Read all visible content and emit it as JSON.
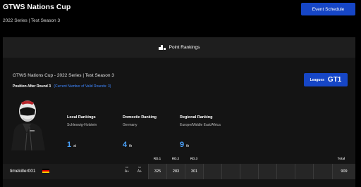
{
  "header": {
    "title": "GTWS Nations Cup",
    "subtitle": "2022 Series | Test Season 3",
    "event_schedule_label": "Event Schedule"
  },
  "panel": {
    "heading": "Point Rankings",
    "championship": "GTWS Nations Cup - 2022 Series | Test Season 3",
    "position_label": "Position After Round 3",
    "valid_rounds": "(Current Number of Valid Rounds: 3)",
    "leagues_label": "Leagues",
    "leagues_value": "GT1"
  },
  "rankings": [
    {
      "heading": "Local Rankings",
      "scope": "Schleswig-Holstein",
      "number": "1",
      "suffix": "st"
    },
    {
      "heading": "Domestic Ranking",
      "scope": "Germany",
      "number": "4",
      "suffix": "th"
    },
    {
      "heading": "Regional Ranking",
      "scope": "Europe/Middle East/Africa",
      "number": "9",
      "suffix": "th"
    }
  ],
  "table": {
    "columns": [
      "RD.1",
      "RD.2",
      "RD.3",
      "Total"
    ],
    "row": {
      "driver": "timekiller001",
      "dr_label": "DR",
      "dr_value": "A+",
      "sr_label": "SR",
      "sr_value": "A+",
      "rd1": "325",
      "rd2": "283",
      "rd3": "301",
      "total": "909"
    }
  },
  "colors": {
    "accent": "#1646c6",
    "rank_number": "#4aa3ff",
    "valid_rounds": "#3e86ff",
    "flag": [
      "#000000",
      "#dd0000",
      "#ffce00"
    ]
  },
  "icons": {
    "heading_icon": "podium-icon",
    "driver": "driver-avatar",
    "flag": "germany-flag-icon"
  }
}
